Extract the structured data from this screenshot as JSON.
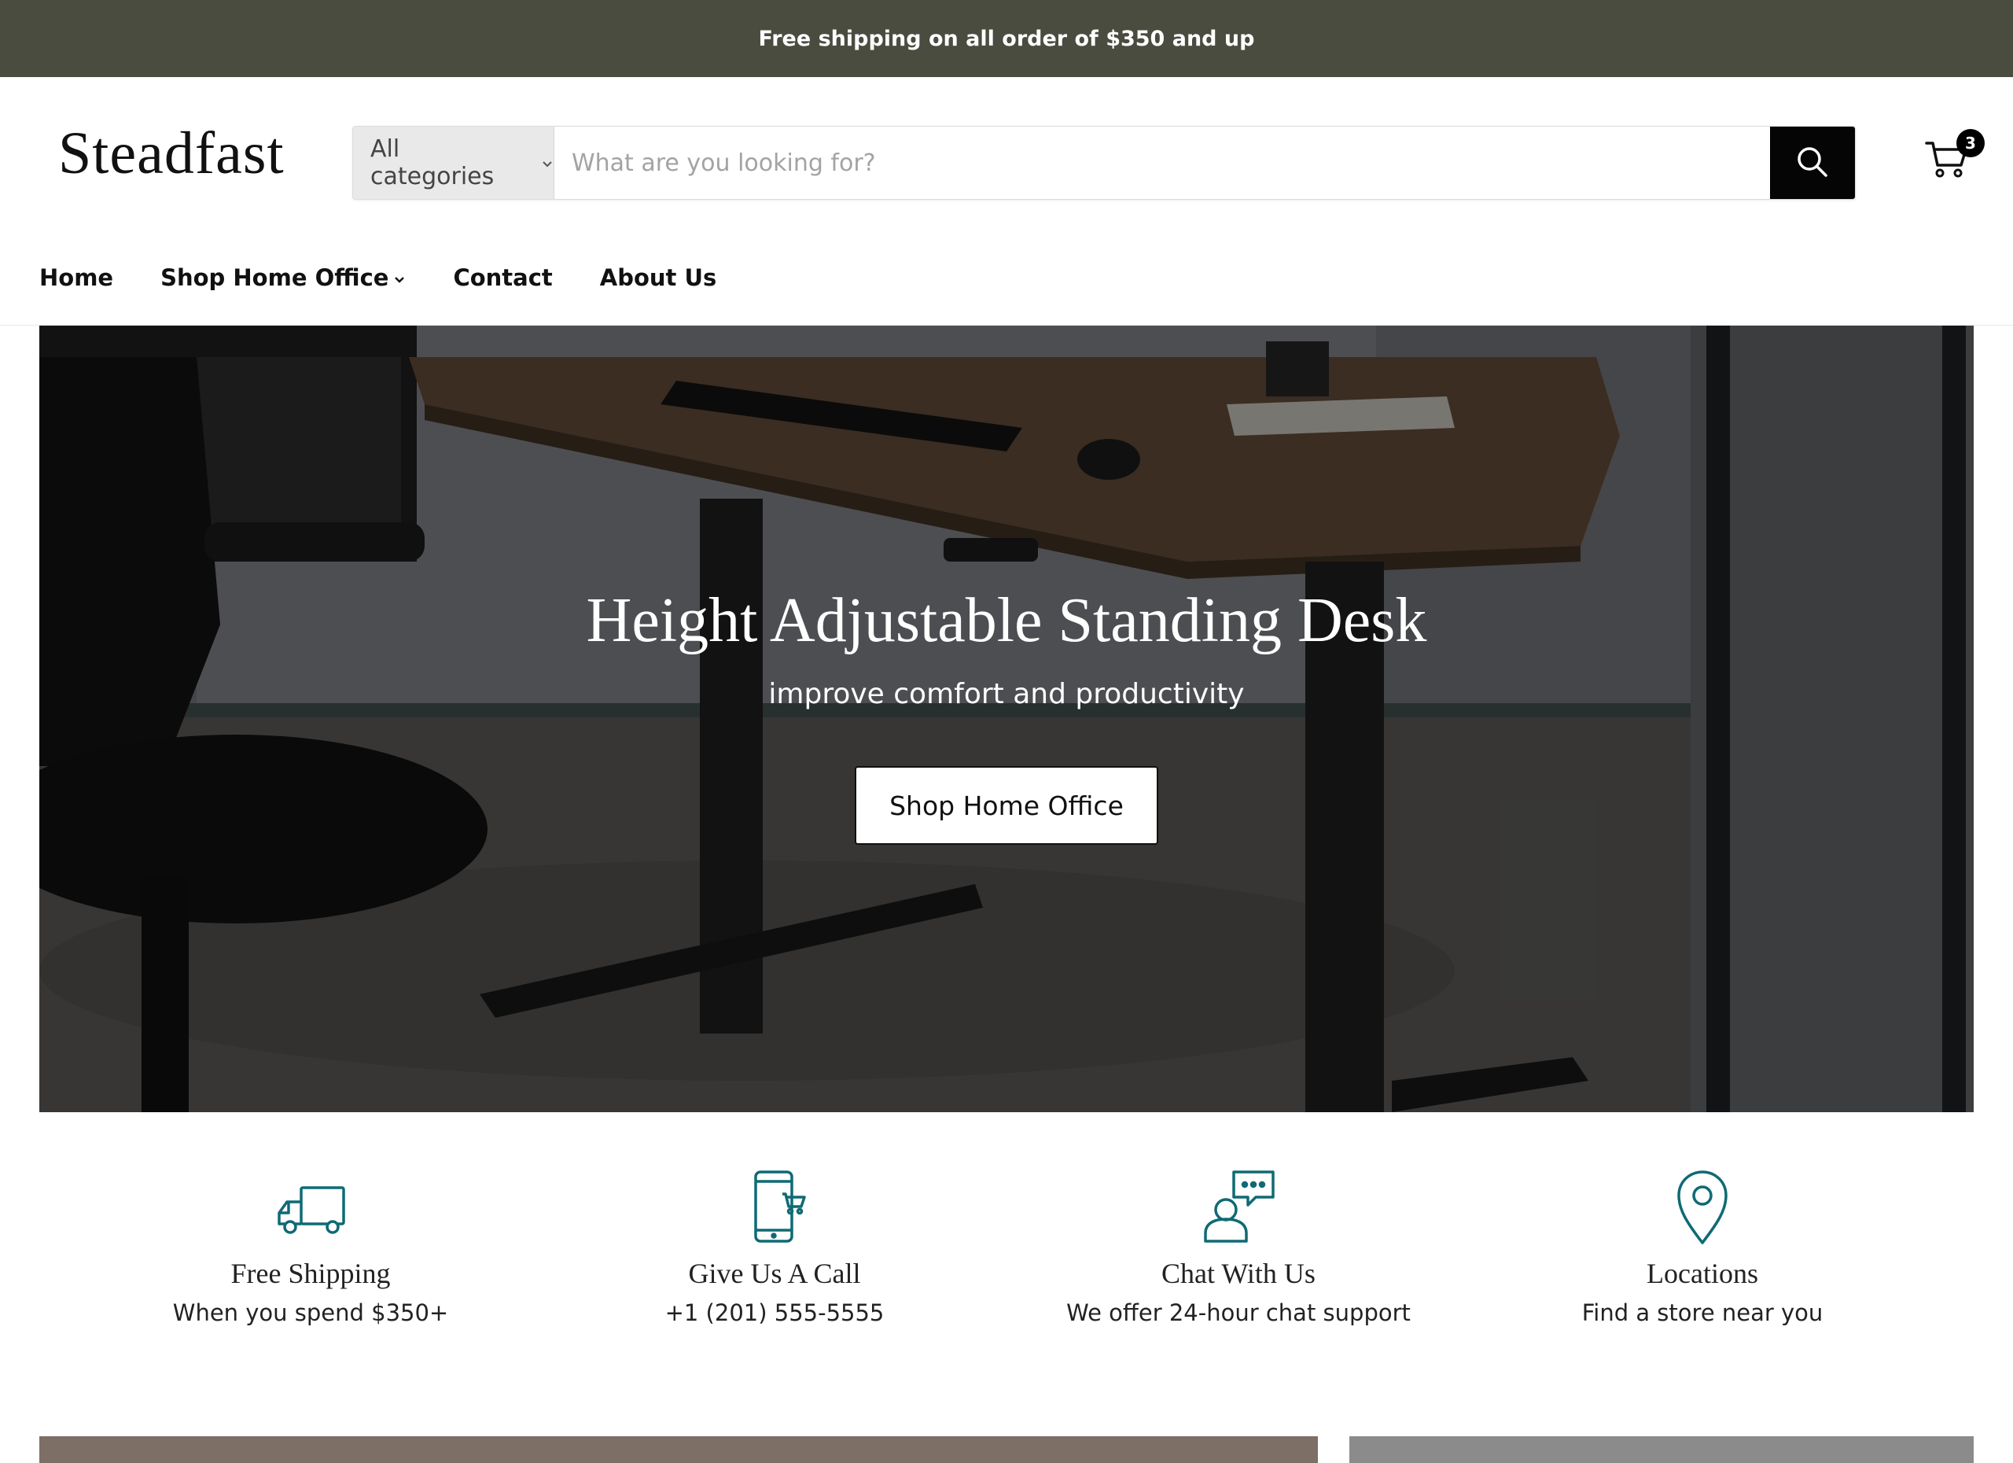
{
  "announcement": "Free shipping on all order of $350 and up",
  "header": {
    "logo": "Steadfast",
    "search": {
      "category_label": "All categories",
      "placeholder": "What are you looking for?"
    },
    "cart_count": "3"
  },
  "nav": {
    "items": [
      {
        "label": "Home"
      },
      {
        "label": "Shop Home Office"
      },
      {
        "label": "Contact"
      },
      {
        "label": "About Us"
      }
    ]
  },
  "hero": {
    "title": "Height Adjustable Standing Desk",
    "subtitle": "improve comfort and productivity",
    "button": "Shop Home Office"
  },
  "features": [
    {
      "icon": "truck-icon",
      "title": "Free Shipping",
      "desc": "When you spend $350+"
    },
    {
      "icon": "phone-cart-icon",
      "title": "Give Us A Call",
      "desc": "+1 (201) 555-5555"
    },
    {
      "icon": "chat-support-icon",
      "title": "Chat With Us",
      "desc": "We offer 24-hour chat support"
    },
    {
      "icon": "location-pin-icon",
      "title": "Locations",
      "desc": "Find a store near you"
    }
  ],
  "colors": {
    "announcement_bg": "#4a4c40",
    "accent_icon": "#0f6a75",
    "button_dark": "#050505"
  }
}
